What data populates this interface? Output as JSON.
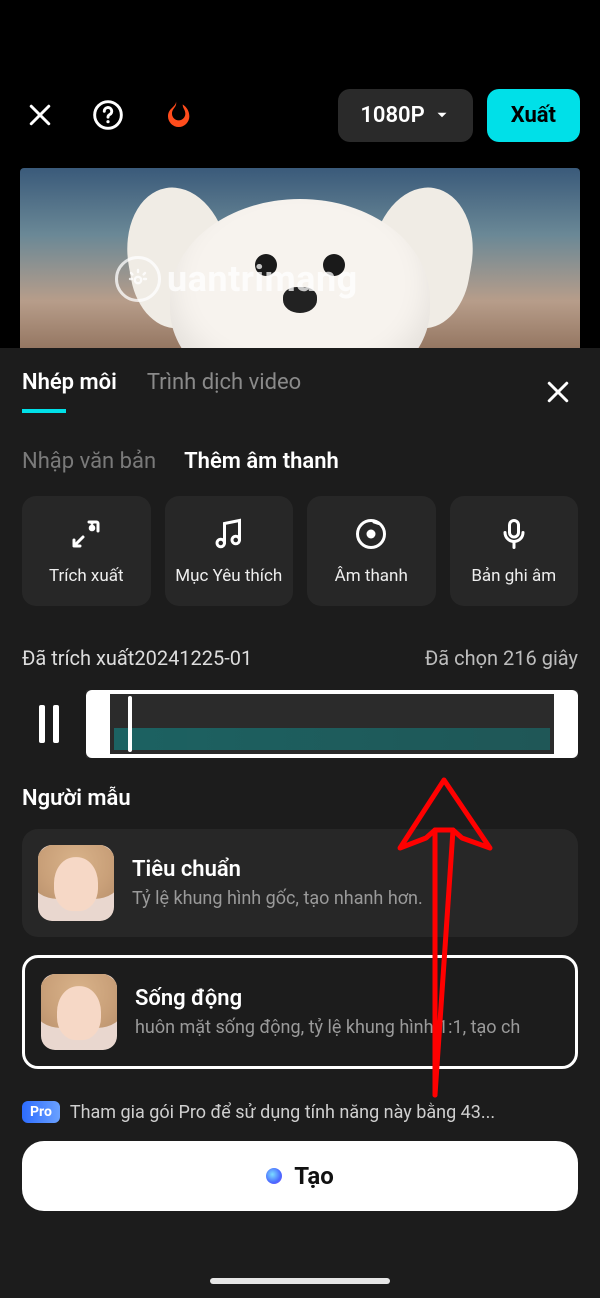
{
  "topbar": {
    "resolution_label": "1080P",
    "export_label": "Xuất"
  },
  "watermark": {
    "text": "uantrimang"
  },
  "sheet": {
    "tabs": [
      {
        "label": "Nhép môi",
        "active": true
      },
      {
        "label": "Trình dịch video",
        "active": false
      }
    ],
    "subtabs": [
      {
        "label": "Nhập văn bản",
        "active": false
      },
      {
        "label": "Thêm âm thanh",
        "active": true
      }
    ],
    "actions": [
      {
        "icon": "extract-icon",
        "label": "Trích xuất"
      },
      {
        "icon": "favorite-icon",
        "label": "Mục Yêu thích"
      },
      {
        "icon": "audio-icon",
        "label": "Âm thanh"
      },
      {
        "icon": "record-icon",
        "label": "Bản ghi âm"
      }
    ],
    "clip": {
      "name": "Đã trích xuất20241225-01",
      "selected_label": "Đã chọn 216 giây"
    },
    "models_title": "Người mẫu",
    "models": [
      {
        "name": "Tiêu chuẩn",
        "desc": "Tỷ lệ khung hình gốc, tạo nhanh hơn.",
        "selected": false
      },
      {
        "name": "Sống động",
        "desc": "huôn mặt sống động, tỷ lệ khung hình 1:1, tạo ch",
        "selected": true
      }
    ],
    "pro": {
      "badge": "Pro",
      "text": "Tham gia gói Pro để sử dụng tính năng này bằng 43..."
    },
    "create_label": "Tạo"
  }
}
